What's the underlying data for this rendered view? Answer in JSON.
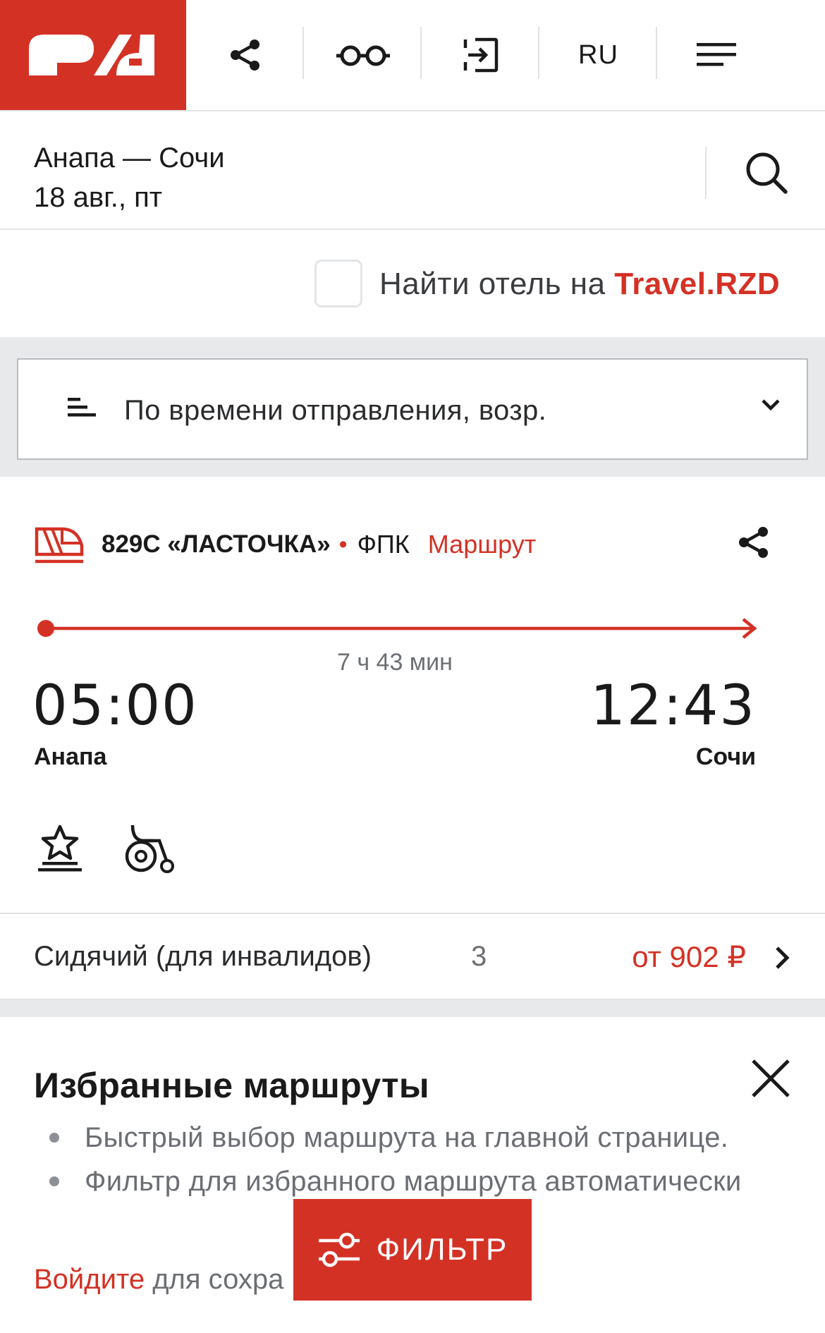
{
  "header": {
    "logo_alt": "РЖД",
    "language": "RU"
  },
  "search": {
    "route": "Анапа — Сочи",
    "date": "18 авг., пт"
  },
  "hotel": {
    "label_prefix": "Найти отель на ",
    "brand": "Travel.RZD",
    "checked": false
  },
  "sort": {
    "selected": "По времени отправления, возр."
  },
  "train": {
    "name": "829С «ЛАСТОЧКА»",
    "separator": "•",
    "carrier": "ФПК",
    "route_link": "Маршрут",
    "duration": "7 ч 43 мин",
    "departure_time": "05:00",
    "arrival_time": "12:43",
    "departure_station": "Анапа",
    "arrival_station": "Сочи",
    "features": [
      "rating-star-icon",
      "wheelchair-icon"
    ],
    "seats": [
      {
        "type": "Сидячий (для инвалидов)",
        "count": "3",
        "price": "от 902 ₽"
      }
    ]
  },
  "favorites": {
    "title": "Избранные маршруты",
    "bullets": [
      "Быстрый выбор маршрута на главной странице.",
      "Фильтр для избранного маршрута автоматически"
    ],
    "login_link": "Войдите",
    "login_rest": " для сохра",
    "login_tail": "."
  },
  "filter": {
    "label": "ФИЛЬТР"
  },
  "colors": {
    "brand_red": "#d43125",
    "background_gray": "#e7e9eb",
    "text_dark": "#1a1a1a",
    "text_muted": "#6b6e73"
  }
}
